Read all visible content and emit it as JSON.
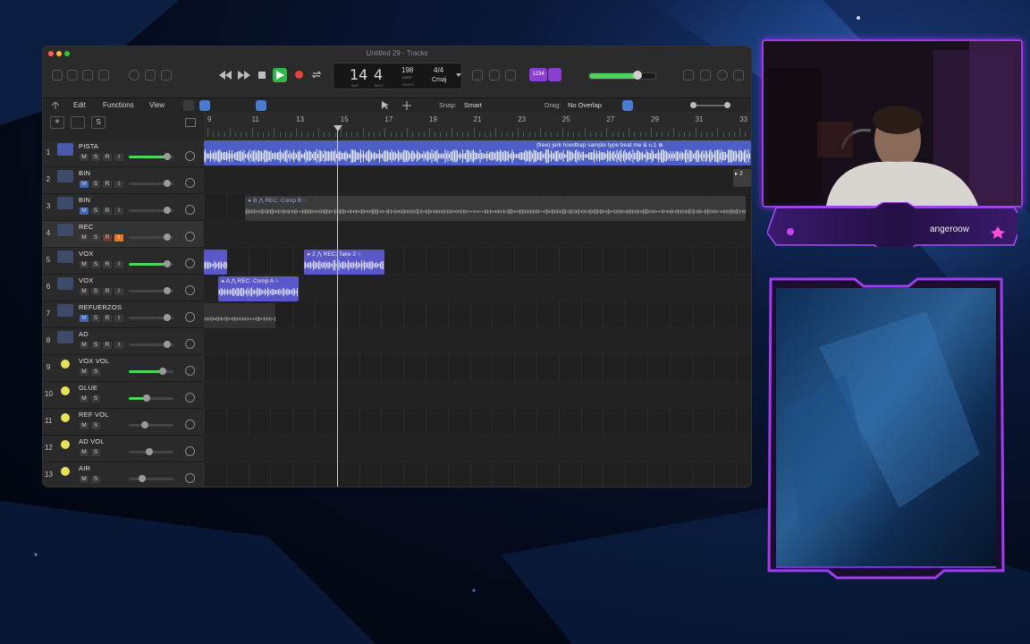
{
  "window": {
    "title": "Untitled 29 - Tracks"
  },
  "lcd": {
    "bar": "14",
    "beat": "4",
    "bar_label": "BAR",
    "beat_label": "BEAT",
    "tempo": "198",
    "tempo_label": "KEEP",
    "tempo_sub": "TEMPO",
    "signature": "4/4",
    "key": "Cmaj"
  },
  "toolbar": {
    "badge_text": "1234"
  },
  "menus": {
    "edit": "Edit",
    "functions": "Functions",
    "view": "View",
    "snap_label": "Snap:",
    "snap_value": "Smart",
    "drag_label": "Drag:",
    "drag_value": "No Overlap"
  },
  "track_header": {
    "add": "+",
    "s": "S"
  },
  "ruler": {
    "bars": [
      "9",
      "11",
      "13",
      "15",
      "17",
      "19",
      "21",
      "23",
      "25",
      "27",
      "29",
      "31",
      "33"
    ]
  },
  "tracks": [
    {
      "num": "1",
      "name": "PISTA",
      "fader": 0.85,
      "buttons": [
        "M",
        "S",
        "R",
        "I"
      ]
    },
    {
      "num": "2",
      "name": "BIN",
      "fader": 0.85,
      "buttons": [
        "M",
        "S",
        "R",
        "I"
      ]
    },
    {
      "num": "3",
      "name": "BIN",
      "fader": 0.85,
      "buttons": [
        "M",
        "S",
        "R",
        "I"
      ]
    },
    {
      "num": "4",
      "name": "REC",
      "fader": 0.85,
      "buttons": [
        "M",
        "S",
        "R",
        "I"
      ]
    },
    {
      "num": "5",
      "name": "VOX",
      "fader": 0.85,
      "buttons": [
        "M",
        "S",
        "R",
        "I"
      ]
    },
    {
      "num": "6",
      "name": "VOX",
      "fader": 0.85,
      "buttons": [
        "M",
        "S",
        "R",
        "I"
      ]
    },
    {
      "num": "7",
      "name": "REFUERZOS",
      "fader": 0.85,
      "buttons": [
        "M",
        "S",
        "R",
        "I"
      ]
    },
    {
      "num": "8",
      "name": "AD",
      "fader": 0.85,
      "buttons": [
        "M",
        "S",
        "R",
        "I"
      ]
    },
    {
      "num": "9",
      "name": "VOX VOL",
      "fader": 0.75,
      "buttons": [
        "M",
        "S"
      ]
    },
    {
      "num": "10",
      "name": "GLUE",
      "fader": 0.4,
      "buttons": [
        "M",
        "S"
      ]
    },
    {
      "num": "11",
      "name": "REF VOL",
      "fader": 0.35,
      "buttons": [
        "M",
        "S"
      ]
    },
    {
      "num": "12",
      "name": "AD VOL",
      "fader": 0.45,
      "buttons": [
        "M",
        "S"
      ]
    },
    {
      "num": "13",
      "name": "AIR",
      "fader": 0.3,
      "buttons": [
        "M",
        "S"
      ]
    }
  ],
  "regions": {
    "pista": "(free) jerk  hoodtrap  sample type beat me & u.1  ⊕",
    "bin_comp": "▸ B  ⋀  REC: Comp B  ○",
    "vox_take": "▸ 2  ⋀  REC: Take 2  ○",
    "vox_comp": "▸ A  ⋀  REC: Comp A  ○",
    "right_marker": "▸ 2"
  },
  "stream": {
    "username": "angeroow"
  },
  "colors": {
    "accent": "#9a3ee0",
    "region_blue": "#4d5fc6",
    "meter_green": "#4fd35b"
  }
}
